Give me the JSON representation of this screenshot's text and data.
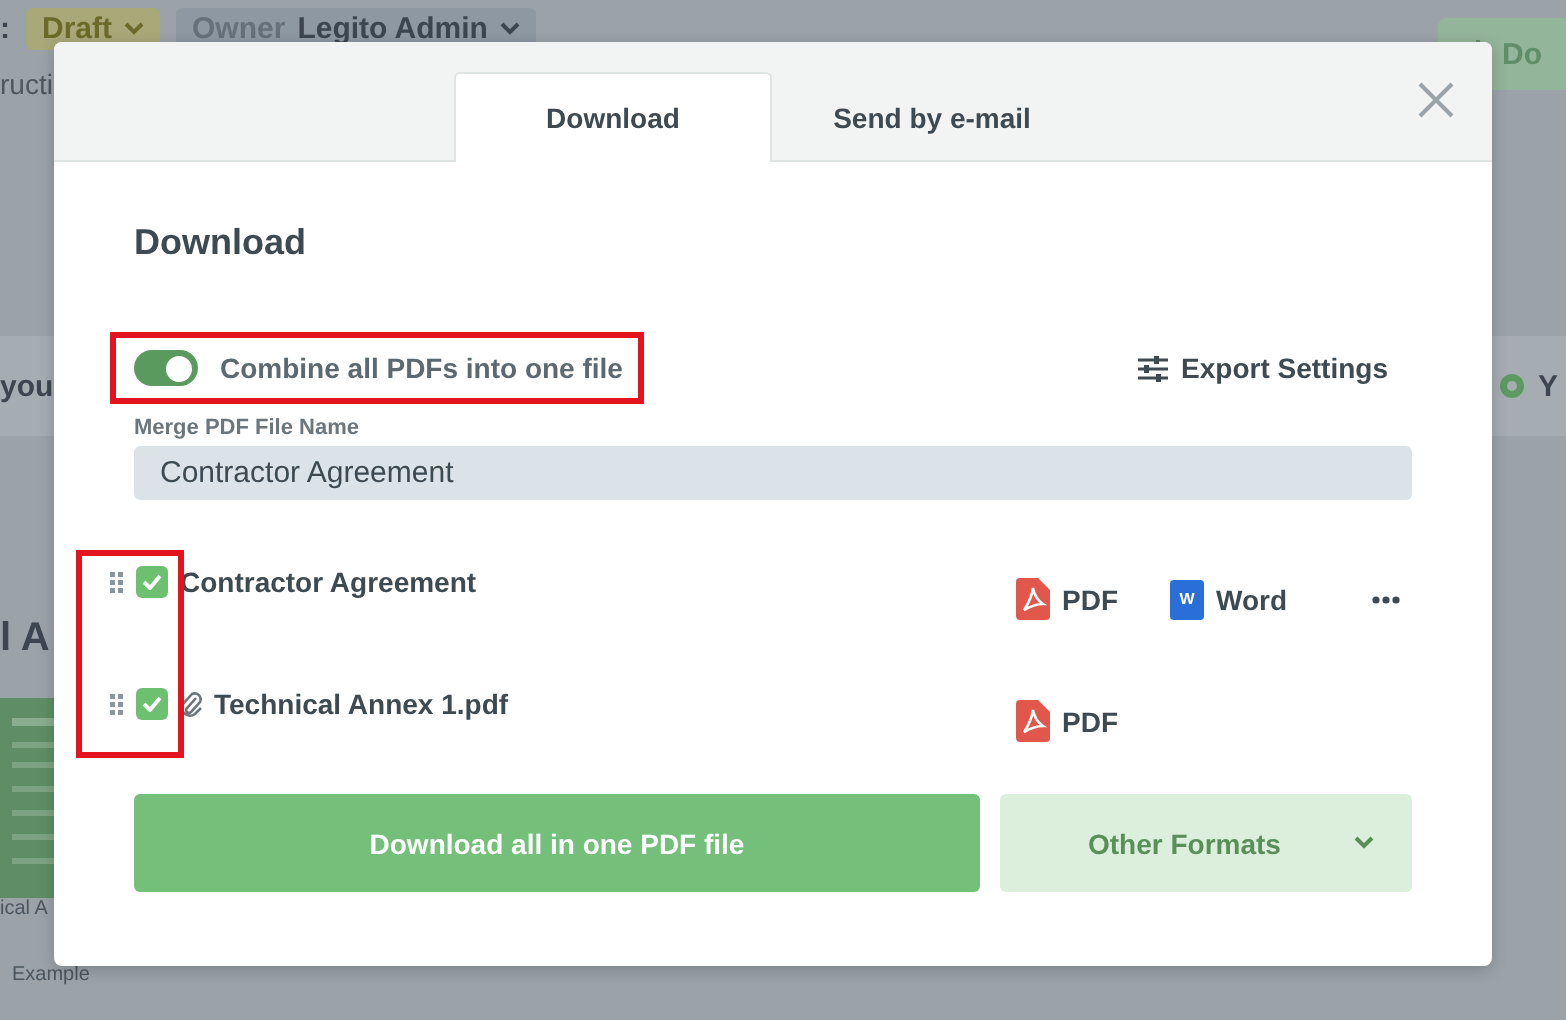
{
  "backdrop": {
    "prefix": ":",
    "status_label": "Draft",
    "owner_label": "Owner",
    "owner_name": "Legito Admin",
    "subtitle": "ructi",
    "download_button": "Do",
    "banner_text": "you",
    "banner_right": "Y",
    "section_title": "l A",
    "thumbnail_caption": "ical A",
    "thumbnail_subcaption": "Example"
  },
  "modal": {
    "tabs": [
      {
        "label": "Download",
        "selected": true
      },
      {
        "label": "Send by e-mail",
        "selected": false
      }
    ],
    "title": "Download",
    "combine": {
      "label": "Combine all PDFs into one file",
      "on": true
    },
    "export_settings": "Export Settings",
    "merge_field": {
      "label": "Merge PDF File Name",
      "value": "Contractor Agreement"
    },
    "files": [
      {
        "name": "Contractor Agreement",
        "checked": true,
        "attachment": false,
        "more": true,
        "formats": [
          {
            "kind": "pdf",
            "label": "PDF"
          },
          {
            "kind": "word",
            "label": "Word",
            "icon_text": "W"
          }
        ]
      },
      {
        "name": "Technical Annex 1.pdf",
        "checked": true,
        "attachment": true,
        "more": false,
        "formats": [
          {
            "kind": "pdf",
            "label": "PDF"
          }
        ]
      }
    ],
    "primary_button": "Download all in one PDF file",
    "secondary_button": "Other Formats"
  }
}
